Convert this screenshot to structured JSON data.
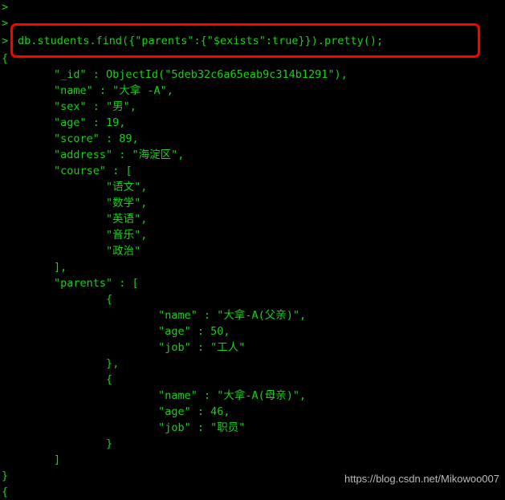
{
  "terminal": {
    "type": "mongodb-shell",
    "background_color": "#000000",
    "text_color": "#17d117",
    "highlight_color": "#fe0000",
    "prompt_symbol": ">",
    "empty_prompt_rows": [
      ">",
      ">",
      ">"
    ],
    "command": "db.students.find({\"parents\":{\"$exists\":true}}).pretty();",
    "output_lines": [
      "{",
      "        \"_id\" : ObjectId(\"5deb32c6a65eab9c314b1291\"),",
      "        \"name\" : \"大拿 -A\",",
      "        \"sex\" : \"男\",",
      "        \"age\" : 19,",
      "        \"score\" : 89,",
      "        \"address\" : \"海淀区\",",
      "        \"course\" : [",
      "                \"语文\",",
      "                \"数学\",",
      "                \"英语\",",
      "                \"音乐\",",
      "                \"政治\"",
      "        ],",
      "        \"parents\" : [",
      "                {",
      "                        \"name\" : \"大拿-A(父亲)\",",
      "                        \"age\" : 50,",
      "                        \"job\" : \"工人\"",
      "                },",
      "                {",
      "                        \"name\" : \"大拿-A(母亲)\",",
      "                        \"age\" : 46,",
      "                        \"job\" : \"职员\"",
      "                }",
      "        ]",
      "}",
      "{"
    ],
    "document": {
      "_id": "ObjectId(\"5deb32c6a65eab9c314b1291\")",
      "name": "大拿 -A",
      "sex": "男",
      "age": 19,
      "score": 89,
      "address": "海淀区",
      "course": [
        "语文",
        "数学",
        "英语",
        "音乐",
        "政治"
      ],
      "parents": [
        {
          "name": "大拿-A(父亲)",
          "age": 50,
          "job": "工人"
        },
        {
          "name": "大拿-A(母亲)",
          "age": 46,
          "job": "职员"
        }
      ]
    }
  },
  "watermark": {
    "text": "https://blog.csdn.net/Mikowoo007",
    "color": "#b9b9b9"
  }
}
